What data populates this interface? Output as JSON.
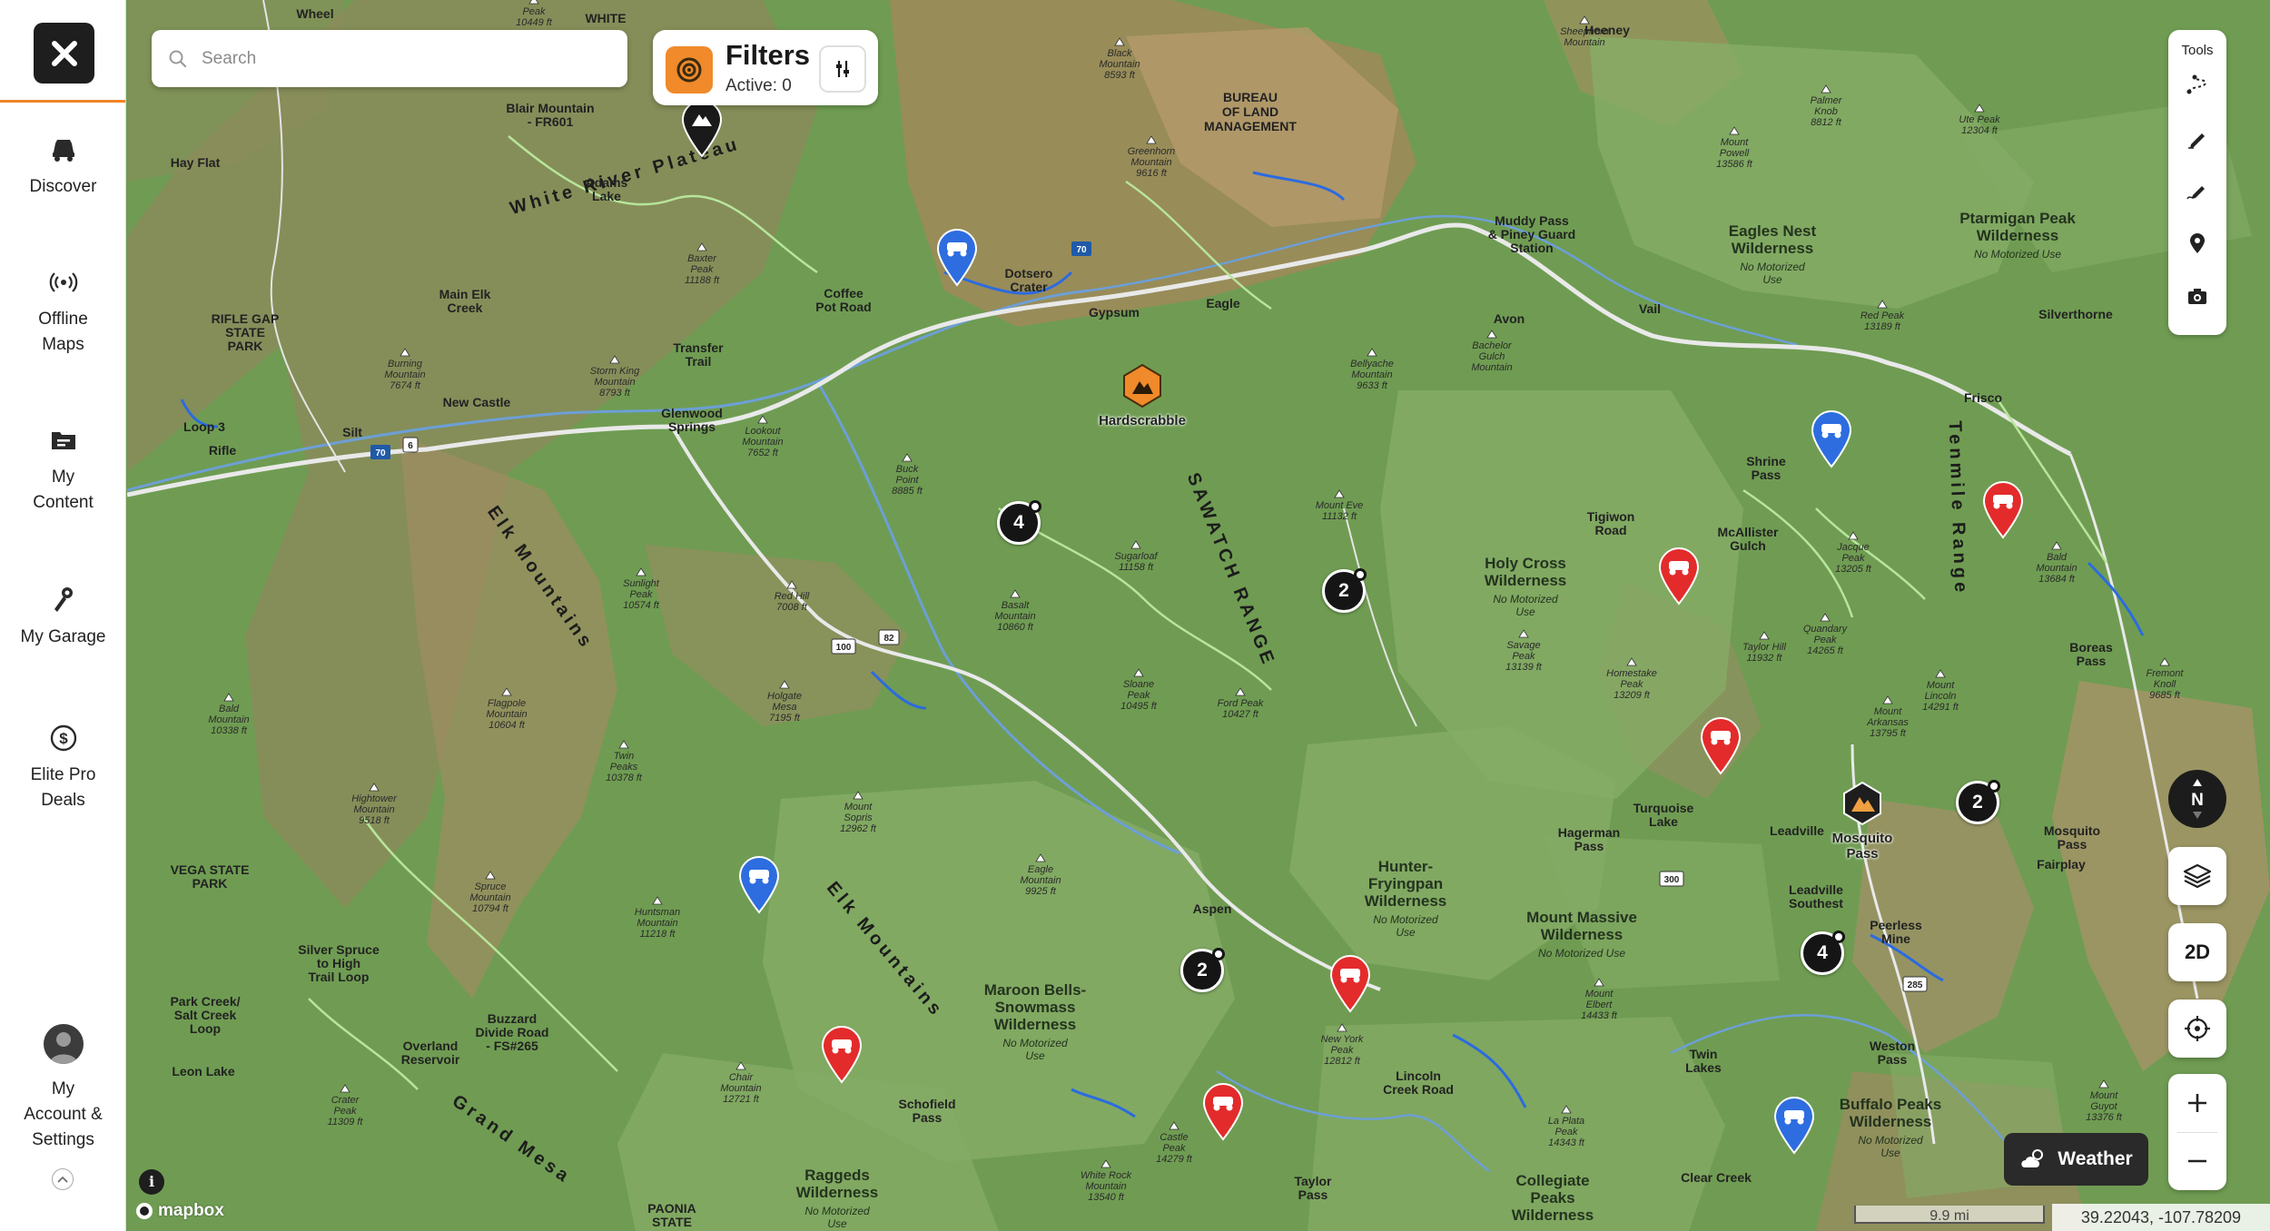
{
  "sidebar": {
    "close_label": "×",
    "items": [
      {
        "id": "discover",
        "label": "Discover",
        "icon": "discover-icon"
      },
      {
        "id": "offline-maps",
        "label": "Offline\nMaps",
        "icon": "offline-maps-icon"
      },
      {
        "id": "my-content",
        "label": "My\nContent",
        "icon": "folder-icon"
      },
      {
        "id": "my-garage",
        "label": "My Garage",
        "icon": "garage-icon"
      },
      {
        "id": "elite-pro-deals",
        "label": "Elite Pro\nDeals",
        "icon": "dollar-icon"
      },
      {
        "id": "account",
        "label": "My\nAccount &\nSettings",
        "icon": "avatar-icon"
      }
    ],
    "accent_color": "#f0852b"
  },
  "search": {
    "placeholder": "Search",
    "value": ""
  },
  "filters": {
    "title": "Filters",
    "active_text": "Active: 0",
    "icon": "sliders-icon",
    "brand_color": "#f08a2a"
  },
  "tools": {
    "title": "Tools",
    "items": [
      "route-icon",
      "pencil-icon",
      "edit-track-icon",
      "pin-icon",
      "camera-icon"
    ]
  },
  "controls": {
    "compass_label": "N",
    "layers_icon": "layers-icon",
    "mode_label": "2D",
    "locate_icon": "crosshair-icon",
    "zoom_in": "+",
    "zoom_out": "−"
  },
  "weather": {
    "label": "Weather",
    "icon": "cloud-sun-icon"
  },
  "scale": {
    "label": "9.9 mi"
  },
  "coords": {
    "text": "39.22043, -107.78209"
  },
  "attribution": {
    "logo_text": "mapbox",
    "info_label": "i"
  },
  "map": {
    "regions": [
      {
        "name": "BUREAU\nOF LAND\nMANAGEMENT"
      },
      {
        "name": "Eagles Nest\nWilderness",
        "sub": "No Motorized\nUse"
      },
      {
        "name": "Holy Cross\nWilderness",
        "sub": "No Motorized\nUse"
      },
      {
        "name": "Hunter-\nFryingpan\nWilderness",
        "sub": "No Motorized\nUse"
      },
      {
        "name": "Maroon Bells-\nSnowmass\nWilderness",
        "sub": "No Motorized\nUse"
      },
      {
        "name": "Raggeds\nWilderness",
        "sub": "No Motorized\nUse"
      },
      {
        "name": "Collegiate\nPeaks\nWilderness"
      },
      {
        "name": "Mount Massive\nWilderness",
        "sub": "No Motorized Use"
      },
      {
        "name": "Buffalo Peaks\nWilderness",
        "sub": "No Motorized\nUse"
      },
      {
        "name": "Ptarmigan Peak\nWilderness",
        "sub": "No Motorized Use"
      }
    ],
    "ranges": [
      "White River Plateau",
      "SAWATCH RANGE",
      "Elk Mountains",
      "Elk Mountains",
      "Grand Mesa",
      "Tenmile Range"
    ],
    "towns": [
      "Glenwood\nSprings",
      "Gypsum",
      "Eagle",
      "Avon",
      "Vail",
      "Frisco",
      "Leadville",
      "Aspen",
      "Rifle",
      "Silt",
      "New Castle",
      "Silverthorne",
      "Fairplay",
      "Dotsero\nCrater",
      "Main Elk\nCreek",
      "Loop 3",
      "Twin\nLakes",
      "Clear Creek",
      "Shrine\nPass",
      "Hagerman\nPass",
      "Lincoln\nCreek Road",
      "Schofield\nPass",
      "Taylor\nPass",
      "Weston\nPass",
      "Peerless\nMine",
      "Turquoise\nLake",
      "Leon Lake",
      "Overland\nReservoir",
      "Buzzard\nDivide Road\n- FS#265",
      "Park Creek/\nSalt Creek\nLoop",
      "Silver Spruce\nto High\nTrail Loop",
      "Coffee\nPot Road",
      "Transfer\nTrail",
      "Tigiwon\nRoad",
      "McAllister\nGulch",
      "Boreas\nPass",
      "Mosquito\nPass",
      "Leadville\nSouthest",
      "Muddy Pass\n& Piney Guard\nStation",
      "Heeney",
      "Adams\nLake",
      "Blair Mountain\n- FR601",
      "Hay Flat",
      "Wheel",
      "WHITE",
      "RIFLE GAP\nSTATE\nPARK",
      "VEGA STATE\nPARK",
      "PAONIA\nSTATE"
    ],
    "peaks": [
      "Black\nMountain\n8593 ft",
      "Greenhorn\nMountain\n9616 ft",
      "Baxter\nPeak\n11188 ft",
      "Storm King\nMountain\n8793 ft",
      "Burning\nMountain\n7674 ft",
      "Lookout\nMountain\n7652 ft",
      "Buck\nPoint\n8885 ft",
      "Sugarloaf\n11158 ft",
      "Basalt\nMountain\n10860 ft",
      "Red Hill\n7008 ft",
      "Holgate\nMesa\n7195 ft",
      "Sunlight\nPeak\n10574 ft",
      "Flagpole\nMountain\n10604 ft",
      "Bald\nMountain\n10338 ft",
      "Twin\nPeaks\n10378 ft",
      "Hightower\nMountain\n9518 ft",
      "Mount\nSopris\n12962 ft",
      "Eagle\nMountain\n9925 ft",
      "Huntsman\nMountain\n11218 ft",
      "Spruce\nMountain\n10794 ft",
      "Chair\nMountain\n12721 ft",
      "Sloane\nPeak\n10495 ft",
      "Ford Peak\n10427 ft",
      "Mount Eve\n11132 ft",
      "Bellyache\nMountain\n9633 ft",
      "Bachelor\nGulch\nMountain",
      "Savage\nPeak\n13139 ft",
      "Homestake\nPeak\n13209 ft",
      "Jacque\nPeak\n13205 ft",
      "Taylor Hill\n11932 ft",
      "Quandary\nPeak\n14265 ft",
      "Mount\nArkansas\n13795 ft",
      "Mount\nLincoln\n14291 ft",
      "Bald\nMountain\n13684 ft",
      "Red Peak\n13189 ft",
      "Palmer\nKnob\n8812 ft",
      "Mount\nPowell\n13586 ft",
      "Ute Peak\n12304 ft",
      "Sheephorn\nMountain",
      "Castle\nPeak\n14279 ft",
      "White Rock\nMountain\n13540 ft",
      "Crater\nPeak\n11309 ft",
      "Mount\nElbert\n14433 ft",
      "La Plata\nPeak\n14343 ft",
      "New York\nPeak\n12812 ft",
      "Fremont\nKnoll\n9685 ft",
      "Peak\n10449 ft",
      "Mount\nGuyot\n13376 ft"
    ],
    "pois": [
      {
        "name": "Hardscrabble",
        "icon": "hardscrabble-icon"
      },
      {
        "name": "Mosquito\nPass",
        "icon": "mountain-badge-icon"
      }
    ],
    "clusters": [
      {
        "count": "4"
      },
      {
        "count": "2"
      },
      {
        "count": "2"
      },
      {
        "count": "2"
      },
      {
        "count": "4"
      }
    ],
    "highway_shields": [
      "70",
      "6",
      "82",
      "100",
      "70",
      "300",
      "285"
    ],
    "colors": {
      "land_green": "#6f9c52",
      "wilderness": "#86ac67",
      "brown_terrain": "#a88a5e",
      "pin_red": "#e32b2b",
      "pin_blue": "#2d6de0",
      "cluster": "#151515"
    }
  }
}
